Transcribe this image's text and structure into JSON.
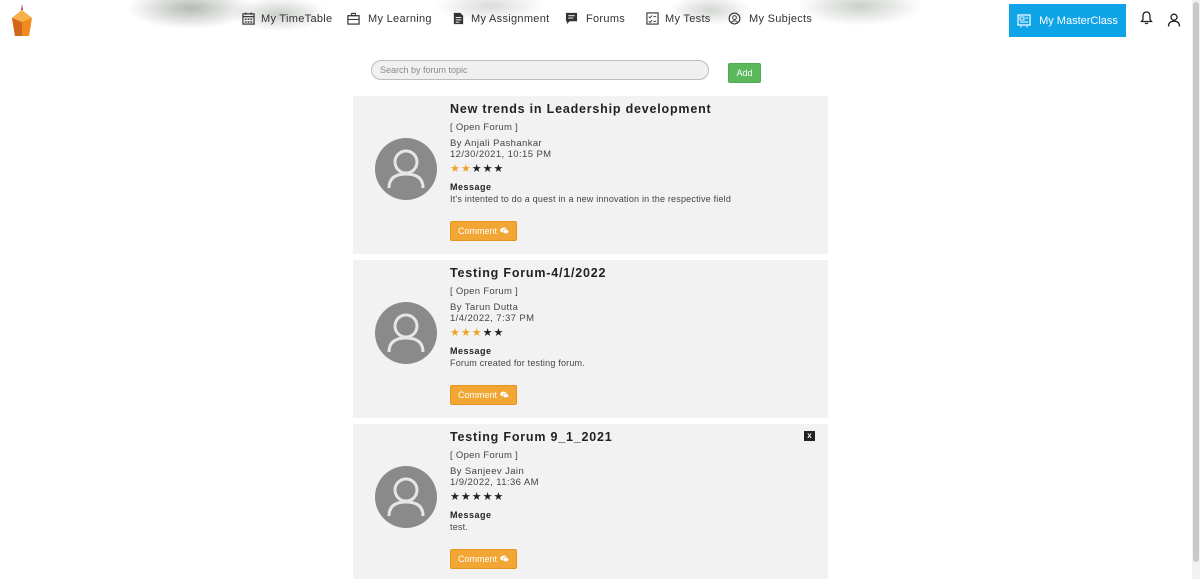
{
  "nav": {
    "items": [
      {
        "label": "My TimeTable",
        "icon": "calendar-icon"
      },
      {
        "label": "My Learning",
        "icon": "briefcase-icon"
      },
      {
        "label": "My Assignment",
        "icon": "document-icon"
      },
      {
        "label": "Forums",
        "icon": "chat-icon"
      },
      {
        "label": "My Tests",
        "icon": "test-icon"
      },
      {
        "label": "My Subjects",
        "icon": "subjects-icon"
      }
    ],
    "masterclass_label": "My MasterClass"
  },
  "search": {
    "placeholder": "Search by forum topic",
    "value": ""
  },
  "add_label": "Add",
  "colors": {
    "accent": "#0fa3e8",
    "add": "#5cb85c",
    "comment": "#f2a633",
    "star_on": "#f0a32a",
    "star_off": "#222222"
  },
  "forums": [
    {
      "title": "New trends in Leadership development",
      "tag": "[ Open Forum ]",
      "author": "By Anjali Pashankar",
      "date": "12/30/2021, 10:15 PM",
      "rating": 2,
      "rating_max": 5,
      "message_label": "Message",
      "message": "It's intented to do a quest in a new innovation in the respective field",
      "comment_label": "Comment"
    },
    {
      "title": "Testing Forum-4/1/2022",
      "tag": "[ Open Forum ]",
      "author": "By Tarun Dutta",
      "date": "1/4/2022, 7:37 PM",
      "rating": 3,
      "rating_max": 5,
      "message_label": "Message",
      "message": "Forum created for testing forum.",
      "comment_label": "Comment"
    },
    {
      "title": "Testing Forum 9_1_2021",
      "tag": "[ Open Forum ]",
      "author": "By Sanjeev Jain",
      "date": "1/9/2022, 11:36 AM",
      "rating": 0,
      "rating_max": 5,
      "message_label": "Message",
      "message": "test.",
      "comment_label": "Comment",
      "close_label": "x"
    }
  ]
}
